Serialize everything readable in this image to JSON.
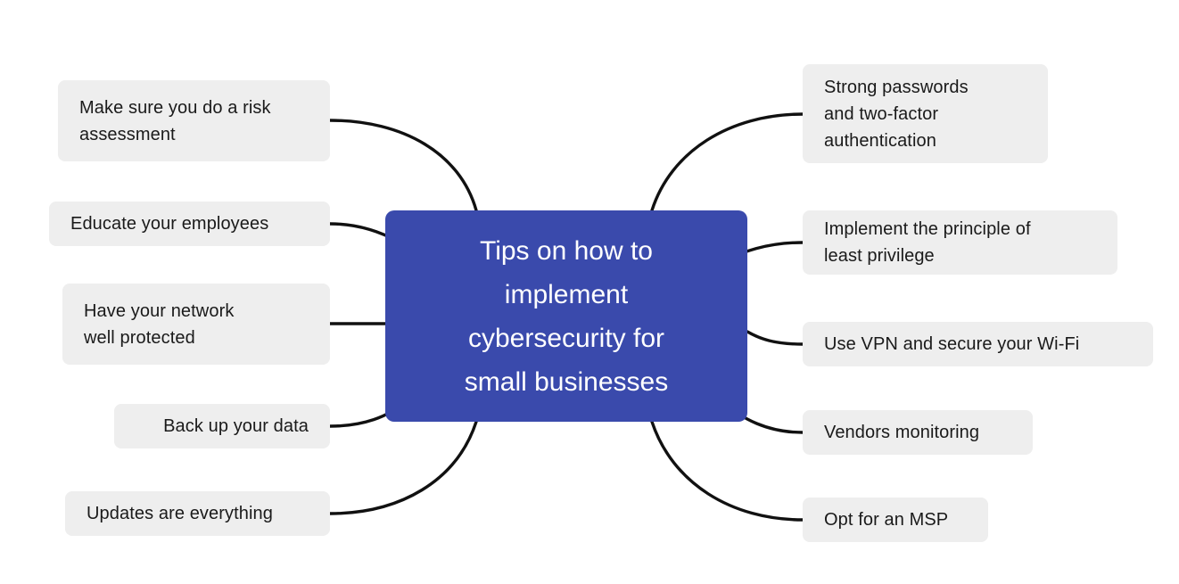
{
  "diagram": {
    "type": "mind-map",
    "title": "Tips on how to implement cybersecurity for small businesses",
    "background_color": "#ffffff",
    "central_node": {
      "label": "Tips on how to implement cybersecurity for small businesses",
      "lines": [
        "Tips on how to",
        "implement",
        "cybersecurity for",
        "small businesses"
      ],
      "fill_color": "#3a4aac",
      "text_color": "#ffffff"
    },
    "branch_style": {
      "fill_color": "#eeeeee",
      "text_color": "#1a1a1a",
      "connector_color": "#111111",
      "connector_width": 3
    },
    "left_branches": [
      {
        "label": "Make sure you do a risk assessment",
        "lines": [
          "Make sure you do a risk",
          "assessment"
        ]
      },
      {
        "label": "Educate your employees",
        "lines": [
          "Educate your employees"
        ]
      },
      {
        "label": "Have your network well protected",
        "lines": [
          "Have your network",
          "well protected"
        ]
      },
      {
        "label": "Back up your data",
        "lines": [
          "Back up your data"
        ]
      },
      {
        "label": "Updates are everything",
        "lines": [
          "Updates are everything"
        ]
      }
    ],
    "right_branches": [
      {
        "label": "Strong passwords and two-factor authentication",
        "lines": [
          "Strong passwords",
          "and two-factor",
          "authentication"
        ]
      },
      {
        "label": "Implement the principle of least privilege",
        "lines": [
          "Implement the principle of",
          "least privilege"
        ]
      },
      {
        "label": "Use VPN and secure your Wi-Fi",
        "lines": [
          "Use VPN and secure your Wi-Fi"
        ]
      },
      {
        "label": "Vendors monitoring",
        "lines": [
          "Vendors monitoring"
        ]
      },
      {
        "label": "Opt for an MSP",
        "lines": [
          "Opt for an MSP"
        ]
      }
    ]
  }
}
